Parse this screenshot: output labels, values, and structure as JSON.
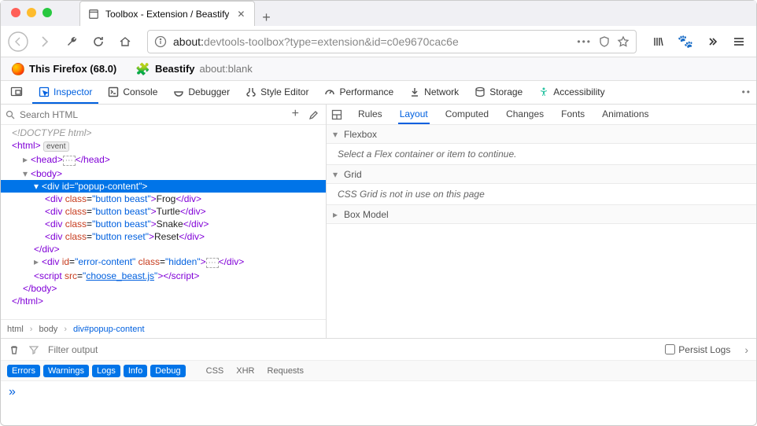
{
  "window": {
    "tab_title": "Toolbox - Extension / Beastify"
  },
  "urlbar": {
    "prefix": "about:",
    "rest": "devtools-toolbox?type=extension&id=c0e9670cac6e"
  },
  "context": {
    "firefox_label": "This Firefox (68.0)",
    "ext_name": "Beastify",
    "ext_url": "about:blank"
  },
  "devtools_tabs": {
    "inspector": "Inspector",
    "console": "Console",
    "debugger": "Debugger",
    "style_editor": "Style Editor",
    "performance": "Performance",
    "network": "Network",
    "storage": "Storage",
    "accessibility": "Accessibility"
  },
  "search": {
    "placeholder": "Search HTML"
  },
  "tree": {
    "doctype": "<!DOCTYPE html>",
    "event_badge": "event",
    "popup_id": "popup-content",
    "btn_class": "button beast",
    "reset_class": "button reset",
    "beasts": [
      "Frog",
      "Turtle",
      "Snake"
    ],
    "reset_text": "Reset",
    "error_id": "error-content",
    "hidden_class": "hidden",
    "script_src": "choose_beast.js"
  },
  "crumbs": [
    "html",
    "body",
    "div#popup-content"
  ],
  "right_tabs": [
    "Rules",
    "Layout",
    "Computed",
    "Changes",
    "Fonts",
    "Animations"
  ],
  "flexbox": {
    "title": "Flexbox",
    "body": "Select a Flex container or item to continue."
  },
  "grid": {
    "title": "Grid",
    "body": "CSS Grid is not in use on this page"
  },
  "box_model": {
    "title": "Box Model"
  },
  "console_filter": {
    "placeholder": "Filter output",
    "persist": "Persist Logs"
  },
  "filter_pills": [
    "Errors",
    "Warnings",
    "Logs",
    "Info",
    "Debug"
  ],
  "filter_gray": [
    "CSS",
    "XHR",
    "Requests"
  ],
  "prompt": "»"
}
